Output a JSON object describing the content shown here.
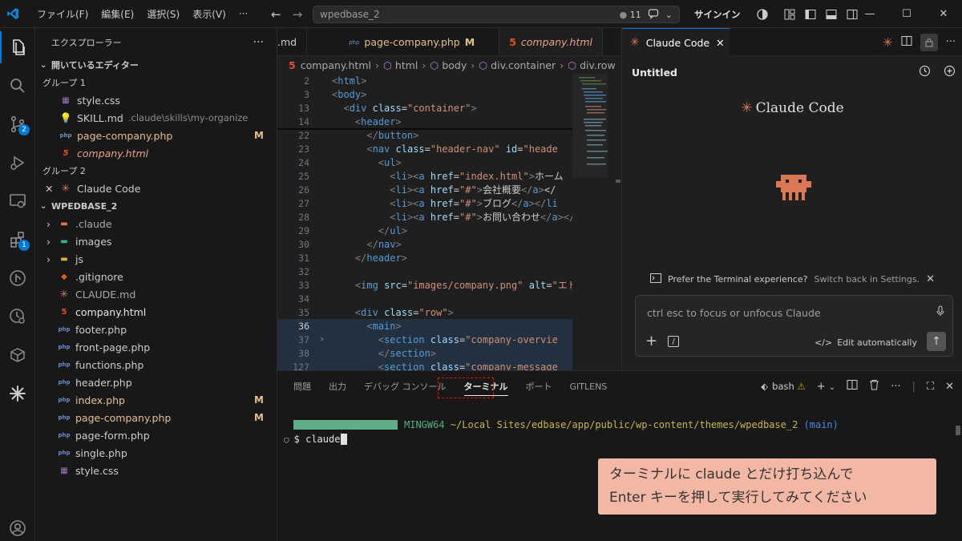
{
  "titlebar": {
    "menus": [
      "ファイル(F)",
      "編集(E)",
      "選択(S)",
      "表示(V)",
      "···"
    ],
    "search": "wpedbase_2",
    "change_count": "11",
    "signin": "サインイン"
  },
  "sidebar": {
    "title": "エクスプローラー",
    "open_editors_title": "開いているエディター",
    "group1": "グループ 1",
    "open_editors_g1": [
      {
        "name": "style.css",
        "desc": "",
        "icon": "css-icon",
        "mark": ""
      },
      {
        "name": "SKILL.md",
        "desc": ".claude\\skills\\my-organize",
        "icon": "lightbulb-icon",
        "mark": ""
      },
      {
        "name": "page-company.php",
        "desc": "",
        "icon": "php-icon",
        "mark": "M"
      },
      {
        "name": "company.html",
        "desc": "",
        "icon": "html-icon",
        "mark": ""
      }
    ],
    "group2": "グループ 2",
    "open_editors_g2": [
      {
        "name": "Claude Code"
      }
    ],
    "folder_title": "WPEDBASE_2",
    "files": [
      {
        "name": ".claude",
        "type": "folder"
      },
      {
        "name": "images",
        "type": "folder"
      },
      {
        "name": "js",
        "type": "folder"
      },
      {
        "name": ".gitignore",
        "type": "git"
      },
      {
        "name": "CLAUDE.md",
        "type": "claude"
      },
      {
        "name": "company.html",
        "type": "html"
      },
      {
        "name": "footer.php",
        "type": "php"
      },
      {
        "name": "front-page.php",
        "type": "php"
      },
      {
        "name": "functions.php",
        "type": "php"
      },
      {
        "name": "header.php",
        "type": "php"
      },
      {
        "name": "index.php",
        "type": "php",
        "mark": "M"
      },
      {
        "name": "page-company.php",
        "type": "php",
        "mark": "M"
      },
      {
        "name": "page-form.php",
        "type": "php"
      },
      {
        "name": "single.php",
        "type": "php"
      },
      {
        "name": "style.css",
        "type": "css"
      }
    ]
  },
  "editor": {
    "tabs": [
      {
        "label": ".md"
      },
      {
        "label": "page-company.php",
        "mark": "M"
      },
      {
        "label": "company.html"
      }
    ],
    "breadcrumb": [
      "company.html",
      "html",
      "body",
      "div.container",
      "div.row"
    ],
    "lines": [
      {
        "n": "2",
        "code": "<html>"
      },
      {
        "n": "3",
        "code": "<body>"
      },
      {
        "n": "13",
        "code": "  <div class=\"container\">"
      },
      {
        "n": "14",
        "code": "    <header>"
      },
      {
        "n": "22",
        "code": "      </button>"
      },
      {
        "n": "23",
        "code": "      <nav class=\"header-nav\" id=\"heade"
      },
      {
        "n": "24",
        "code": "        <ul>"
      },
      {
        "n": "25",
        "code": "          <li><a href=\"index.html\">ホーム"
      },
      {
        "n": "26",
        "code": "          <li><a href=\"#\">会社概要</a></"
      },
      {
        "n": "27",
        "code": "          <li><a href=\"#\">ブログ</a></li"
      },
      {
        "n": "28",
        "code": "          <li><a href=\"#\">お問い合わせ</a></li>"
      },
      {
        "n": "29",
        "code": "        </ul>"
      },
      {
        "n": "30",
        "code": "      </nav>"
      },
      {
        "n": "31",
        "code": "    </header>"
      },
      {
        "n": "32",
        "code": ""
      },
      {
        "n": "33",
        "code": "    <img src=\"images/company.png\" alt=\"エドベー"
      },
      {
        "n": "34",
        "code": ""
      },
      {
        "n": "35",
        "code": "    <div class=\"row\">"
      },
      {
        "n": "36",
        "code": "      <main>"
      },
      {
        "n": "37",
        "code": "        <section class=\"company-overvie"
      },
      {
        "n": "38",
        "code": "        </section>"
      },
      {
        "n": "127",
        "code": "        <section class=\"company-message"
      }
    ]
  },
  "claude_panel": {
    "tab": "Claude Code",
    "title": "Untitled",
    "brand": "Claude Code",
    "hint": "Prefer the Terminal experience?",
    "hint_link": "Switch back in Settings.",
    "placeholder": "ctrl esc to focus or unfocus Claude",
    "edit_mode": "Edit automatically"
  },
  "panel": {
    "tabs": [
      "問題",
      "出力",
      "デバッグ コンソール",
      "ターミナル",
      "ポート",
      "GITLENS"
    ],
    "active_tab": "ターミナル",
    "shell": "bash",
    "terminal": {
      "host": "MINGW64",
      "path": "~/Local Sites/edbase/app/public/wp-content/themes/wpedbase_2",
      "branch": "(main)",
      "prompt": "$",
      "command": "claude"
    }
  },
  "callout": {
    "line1": "ターミナルに claude とだけ打ち込んで",
    "line2": "Enter キーを押して実行してみてください"
  },
  "colors": {
    "accent": "#0078d4",
    "claude_orange": "#d97757",
    "modified": "#e2c08d",
    "callout_bg": "#f3b8a5",
    "highlight": "#e51400"
  }
}
